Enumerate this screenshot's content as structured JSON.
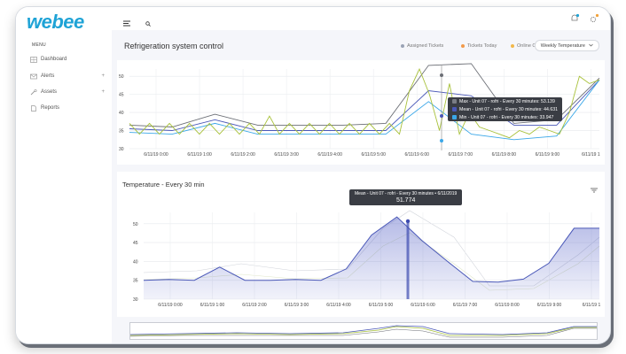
{
  "app": {
    "logo": "webee"
  },
  "sidebar": {
    "menu_title": "MENU",
    "items": [
      {
        "label": "Dashboard",
        "icon": "grid-icon",
        "expandable": false
      },
      {
        "label": "Alerts",
        "icon": "mail-icon",
        "expandable": true
      },
      {
        "label": "Assets",
        "icon": "wrench-icon",
        "expandable": true
      },
      {
        "label": "Reports",
        "icon": "document-icon",
        "expandable": false
      }
    ]
  },
  "topbar": {
    "menu_icon": "hamburger-icon",
    "search_icon": "search-icon",
    "bell_icon": "bell-icon",
    "settings_icon": "gear-icon"
  },
  "header": {
    "title": "Refrigeration system control",
    "legend": [
      {
        "label": "Assigned Tickets",
        "color": "#9aa3b5"
      },
      {
        "label": "Tickets Today",
        "color": "#f29a4a"
      },
      {
        "label": "Online Customer",
        "color": "#f2b84a"
      }
    ],
    "range_select": "Weekly Temperature"
  },
  "chart_top_tooltip": {
    "rows": [
      {
        "label": "Max - Unit 07 - rofri - Every 30 minutes: 53.139",
        "color": "#7a7d85"
      },
      {
        "label": "Mean - Unit 07 - rofri - Every 30 minutes: 44.631",
        "color": "#4a58b8"
      },
      {
        "label": "Min - Unit 07 - rofri - Every 30 minutes: 33.947",
        "color": "#3aa7e8"
      }
    ]
  },
  "second_panel": {
    "title": "Temperature - Every 30 min",
    "filter_icon": "filter-icon"
  },
  "chart_bottom_tooltip": {
    "label": "Mean - Unit 07 - rofri - Every 30 minutes • 6/11/2019",
    "value": "51.774"
  },
  "chart_data": [
    {
      "type": "line",
      "x": [
        "6/11/19 0:00",
        "6/11/19 1:00",
        "6/11/19 2:00",
        "6/11/19 3:00",
        "6/11/19 4:00",
        "6/11/19 5:00",
        "6/11/19 6:00",
        "6/11/19 7:00",
        "6/11/19 8:00",
        "6/11/19 9:00",
        "6/11/19 1"
      ],
      "ylim": [
        30,
        52
      ],
      "yticks": [
        30,
        35,
        40,
        45,
        50
      ],
      "series": [
        {
          "color": "#6b6e75",
          "values": [
            36.5,
            36,
            39.5,
            36.5,
            36.5,
            36.5,
            37,
            53,
            53.5,
            37,
            38,
            49.5
          ]
        },
        {
          "color": "#4a58b8",
          "values": [
            35.5,
            35,
            38,
            35,
            35,
            35,
            35,
            46,
            44.6,
            36.5,
            36.5,
            49
          ]
        },
        {
          "color": "#3aa7e8",
          "values": [
            34.5,
            34,
            37,
            34,
            34,
            34,
            34,
            43,
            34,
            32.5,
            33.5,
            49
          ]
        },
        {
          "color": "#a8c13a",
          "values": [
            37,
            34,
            37,
            34,
            37,
            34,
            37,
            34,
            37,
            34,
            37,
            34,
            37,
            34,
            39,
            34,
            37,
            34,
            37,
            34,
            37,
            34,
            37,
            34,
            37,
            34,
            37,
            34,
            46,
            52,
            45,
            35,
            48,
            34,
            40,
            36,
            35,
            34,
            33,
            35,
            34,
            36,
            35,
            34,
            40,
            50,
            48,
            49
          ]
        }
      ],
      "tooltip_x": "6/11/19 6:00",
      "grid": true
    },
    {
      "type": "area",
      "x": [
        "6/11/19 0:00",
        "6/11/19 1:00",
        "6/11/19 2:00",
        "6/11/19 3:00",
        "6/11/19 4:00",
        "6/11/19 5:00",
        "6/11/19 6:00",
        "6/11/19 7:00",
        "6/11/19 8:00",
        "6/11/19 9:00",
        "6/11/19 1"
      ],
      "ylim": [
        30,
        53
      ],
      "yticks": [
        30,
        35,
        40,
        45,
        50
      ],
      "series": [
        {
          "color": "#4a58b8",
          "values": [
            35,
            35.2,
            35,
            38.5,
            35,
            35,
            35.2,
            35,
            38,
            47,
            51.8,
            45.5,
            40,
            34.7,
            34.5,
            35.3,
            39.5,
            48.8,
            48.8
          ]
        }
      ],
      "grid": true
    }
  ]
}
